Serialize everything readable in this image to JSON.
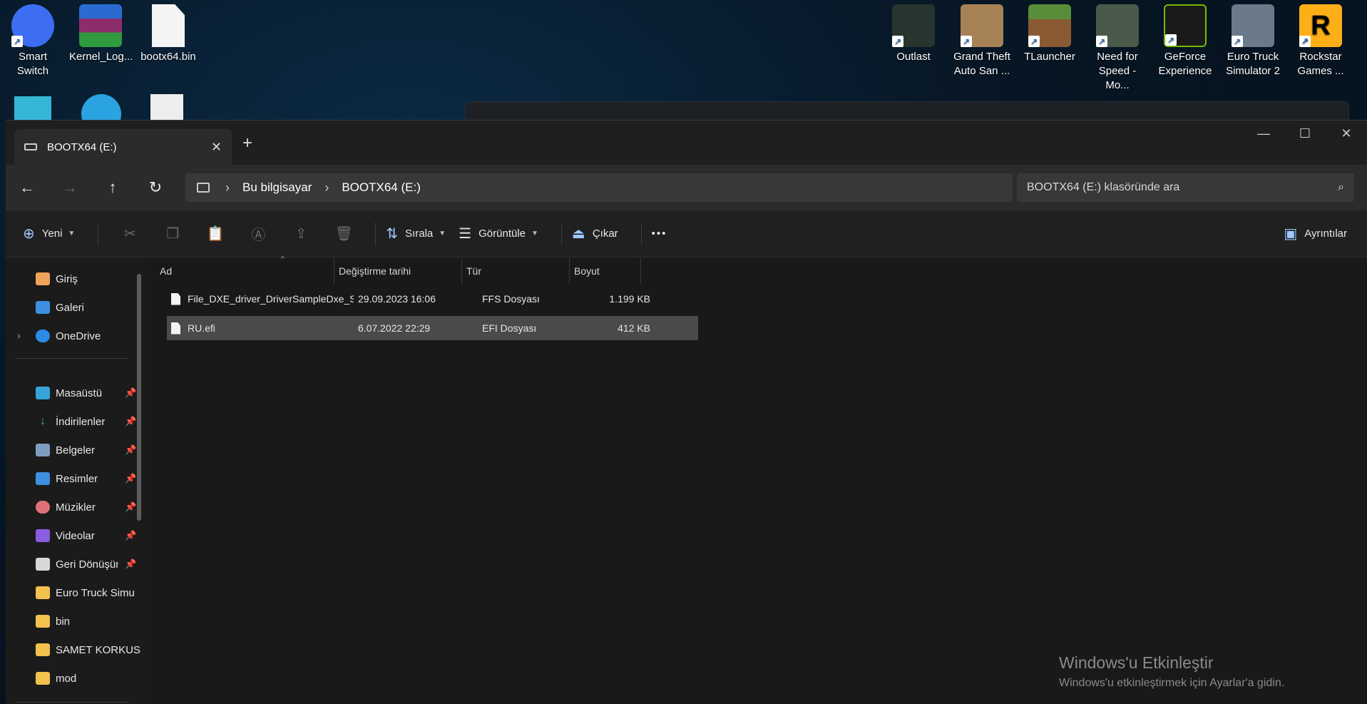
{
  "desktop": {
    "icons_left": [
      {
        "label": "Smart Switch",
        "icon": "smart-switch-icon",
        "color": "#3d6df2"
      },
      {
        "label": "Kernel_Log...",
        "icon": "winrar-archive-icon",
        "color": "#8e2d6b"
      },
      {
        "label": "bootx64.bin",
        "icon": "blank-file-icon",
        "color": "#f4f4f4"
      }
    ],
    "icons_right": [
      {
        "label": "Outlast",
        "icon": "outlast-game-icon",
        "color": "#27352f"
      },
      {
        "label": "Grand Theft Auto San ...",
        "icon": "gta-san-andreas-icon",
        "color": "#a68256"
      },
      {
        "label": "TLauncher",
        "icon": "minecraft-grass-icon",
        "color": "#5a8d3a"
      },
      {
        "label": "Need for Speed - Mo...",
        "icon": "nfs-most-wanted-icon",
        "color": "#4a5a4a"
      },
      {
        "label": "GeForce Experience",
        "icon": "nvidia-icon",
        "color": "#76b900"
      },
      {
        "label": "Euro Truck Simulator 2",
        "icon": "euro-truck-icon",
        "color": "#6b7a8a"
      },
      {
        "label": "Rockstar Games ...",
        "icon": "rockstar-icon",
        "color": "#fcaf17"
      }
    ]
  },
  "window": {
    "tab_title": "BOOTX64 (E:)",
    "new_tab": "+",
    "controls": {
      "minimize": "—",
      "maximize": "☐",
      "close": "✕"
    }
  },
  "nav": {
    "back": "←",
    "forward": "→",
    "up": "↑",
    "refresh": "↻",
    "breadcrumb": [
      "Bu bilgisayar",
      "BOOTX64 (E:)"
    ],
    "search_placeholder": "BOOTX64 (E:) klasöründe ara"
  },
  "toolbar": {
    "new_label": "Yeni",
    "sort_label": "Sırala",
    "view_label": "Görüntüle",
    "eject_label": "Çıkar",
    "more_label": "•••",
    "details_label": "Ayrıntılar"
  },
  "sidebar": {
    "top": [
      {
        "label": "Giriş",
        "icon": "home-icon",
        "color": "#f2a35a"
      },
      {
        "label": "Galeri",
        "icon": "gallery-icon",
        "color": "#3d8fe0"
      },
      {
        "label": "OneDrive",
        "icon": "onedrive-cloud-icon",
        "color": "#2b8be6"
      }
    ],
    "quick": [
      {
        "label": "Masaüstü",
        "icon": "desktop-folder-icon",
        "color": "#36a3d9"
      },
      {
        "label": "İndirilenler",
        "icon": "download-arrow-icon",
        "color": "#3bb38f"
      },
      {
        "label": "Belgeler",
        "icon": "documents-icon",
        "color": "#7d9cc0"
      },
      {
        "label": "Resimler",
        "icon": "pictures-icon",
        "color": "#3d8fe0"
      },
      {
        "label": "Müzikler",
        "icon": "music-icon",
        "color": "#e0707a"
      },
      {
        "label": "Videolar",
        "icon": "videos-icon",
        "color": "#8b5de0"
      },
      {
        "label": "Geri Dönüşüm",
        "icon": "recycle-bin-icon",
        "color": "#d8d8d8"
      },
      {
        "label": "Euro Truck Simu",
        "icon": "folder-icon",
        "color": "#f2c14e"
      },
      {
        "label": "bin",
        "icon": "folder-icon",
        "color": "#f2c14e"
      },
      {
        "label": "SAMET KORKUS",
        "icon": "folder-icon",
        "color": "#f2c14e"
      },
      {
        "label": "mod",
        "icon": "folder-icon",
        "color": "#f2c14e"
      }
    ]
  },
  "table": {
    "columns": [
      "Ad",
      "Değiştirme tarihi",
      "Tür",
      "Boyut"
    ],
    "rows": [
      {
        "name": "File_DXE_driver_DriverSampleDxe_Setup...",
        "date": "29.09.2023 16:06",
        "type": "FFS Dosyası",
        "size": "1.199 KB"
      },
      {
        "name": "RU.efi",
        "date": "6.07.2022 22:29",
        "type": "EFI Dosyası",
        "size": "412 KB"
      }
    ]
  },
  "watermark": {
    "title": "Windows'u Etkinleştir",
    "subtitle": "Windows'u etkinleştirmek için Ayarlar'a gidin."
  }
}
